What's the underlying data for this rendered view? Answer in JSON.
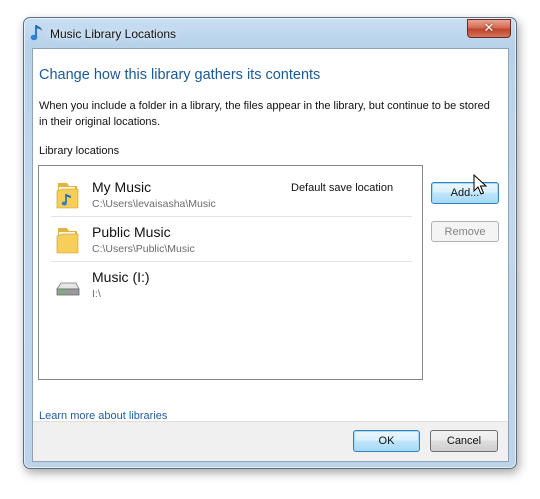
{
  "window": {
    "title": "Music Library Locations",
    "close_glyph": "✕"
  },
  "heading": "Change how this library gathers its contents",
  "description": "When you include a folder in a library, the files appear in the library, but continue to be stored in their original locations.",
  "locations_label": "Library locations",
  "locations": [
    {
      "name": "My Music",
      "path": "C:\\Users\\levaisasha\\Music",
      "badge": "Default save location",
      "icon": "music-folder-icon"
    },
    {
      "name": "Public Music",
      "path": "C:\\Users\\Public\\Music",
      "badge": "",
      "icon": "folder-icon"
    },
    {
      "name": "Music (I:)",
      "path": "I:\\",
      "badge": "",
      "icon": "drive-icon"
    }
  ],
  "buttons": {
    "add": "Add...",
    "remove": "Remove",
    "ok": "OK",
    "cancel": "Cancel"
  },
  "link": "Learn more about libraries",
  "colors": {
    "heading": "#1a5a96",
    "link": "#1f5ea8",
    "frame": "#bcd3ea"
  }
}
